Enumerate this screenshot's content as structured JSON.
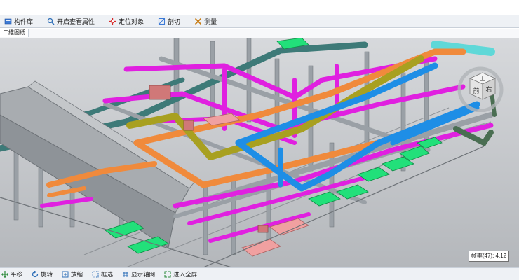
{
  "toolbar": {
    "items": [
      {
        "label": "构件库",
        "icon": "component-library-icon"
      },
      {
        "label": "开启查看属性",
        "icon": "inspect-properties-icon"
      },
      {
        "label": "定位对象",
        "icon": "locate-object-icon"
      },
      {
        "label": "剖切",
        "icon": "section-cut-icon"
      },
      {
        "label": "测量",
        "icon": "measure-icon"
      }
    ]
  },
  "tabs": [
    {
      "label": "二维图纸"
    }
  ],
  "viewport": {
    "view_cube": {
      "top_label": "上",
      "front_label": "前",
      "right_label": "右"
    },
    "fps_label": "帧率(47): 4.12"
  },
  "bottom_toolbar": {
    "items": [
      {
        "label": "平移",
        "icon": "pan-icon"
      },
      {
        "label": "旋转",
        "icon": "rotate-icon"
      },
      {
        "label": "放缩",
        "icon": "zoom-icon"
      },
      {
        "label": "框选",
        "icon": "box-select-icon"
      },
      {
        "label": "显示轴网",
        "icon": "grid-axis-icon"
      },
      {
        "label": "进入全屏",
        "icon": "fullscreen-icon"
      }
    ]
  },
  "colors": {
    "magenta_pipe": "#e020e0",
    "blue_pipe": "#1e8ee6",
    "orange_pipe": "#f08a3c",
    "olive_pipe": "#a8a020",
    "teal_pipe": "#3d7a78",
    "cyan_pipe": "#5fd8d8",
    "gray_pipe": "#9aa0a6",
    "green_equipment": "#22e07a",
    "pink_equipment": "#f0a0a0"
  }
}
